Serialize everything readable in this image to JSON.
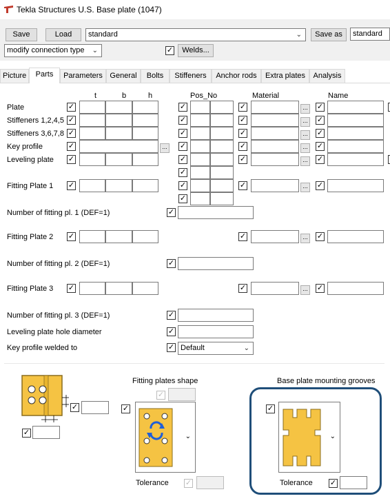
{
  "window": {
    "title": "Tekla Structures  U.S. Base plate (1047)"
  },
  "toolbar": {
    "save_label": "Save",
    "load_label": "Load",
    "attr_file": "standard",
    "save_as_label": "Save as",
    "save_as_value": "standard",
    "modify_type": "modify connection type",
    "welds_label": "Welds..."
  },
  "tabs": [
    "Picture",
    "Parts",
    "Parameters",
    "General",
    "Bolts",
    "Stiffeners",
    "Anchor rods",
    "Extra plates",
    "Analysis"
  ],
  "active_tab": "Parts",
  "columns": {
    "t": "t",
    "b": "b",
    "h": "h",
    "pos_no": "Pos_No",
    "material": "Material",
    "name": "Name"
  },
  "rows": {
    "plate": "Plate",
    "stiff1": "Stiffeners 1,2,4,5",
    "stiff3": "Stiffeners 3,6,7,8",
    "key_profile": "Key profile",
    "leveling": "Leveling plate",
    "fitting1": "Fitting Plate 1",
    "num_fit1": "Number of fitting pl. 1 (DEF=1)",
    "fitting2": "Fitting Plate 2",
    "num_fit2": "Number of fitting pl. 2 (DEF=1)",
    "fitting3": "Fitting Plate 3",
    "num_fit3": "Number of fitting pl. 3 (DEF=1)",
    "hole_diam": "Leveling plate hole diameter",
    "key_welded": "Key profile welded to"
  },
  "key_welded_value": "Default",
  "bottom": {
    "fitting_shape_title": "Fitting plates shape",
    "grooves_title": "Base plate mounting grooves",
    "tolerance1": "Tolerance",
    "tolerance2": "Tolerance"
  },
  "colors": {
    "accent_frame": "#1f4e79",
    "plate_fill": "#f5c343",
    "plate_edge": "#8a6d1e",
    "rotate_icon": "#1f5fd8"
  }
}
